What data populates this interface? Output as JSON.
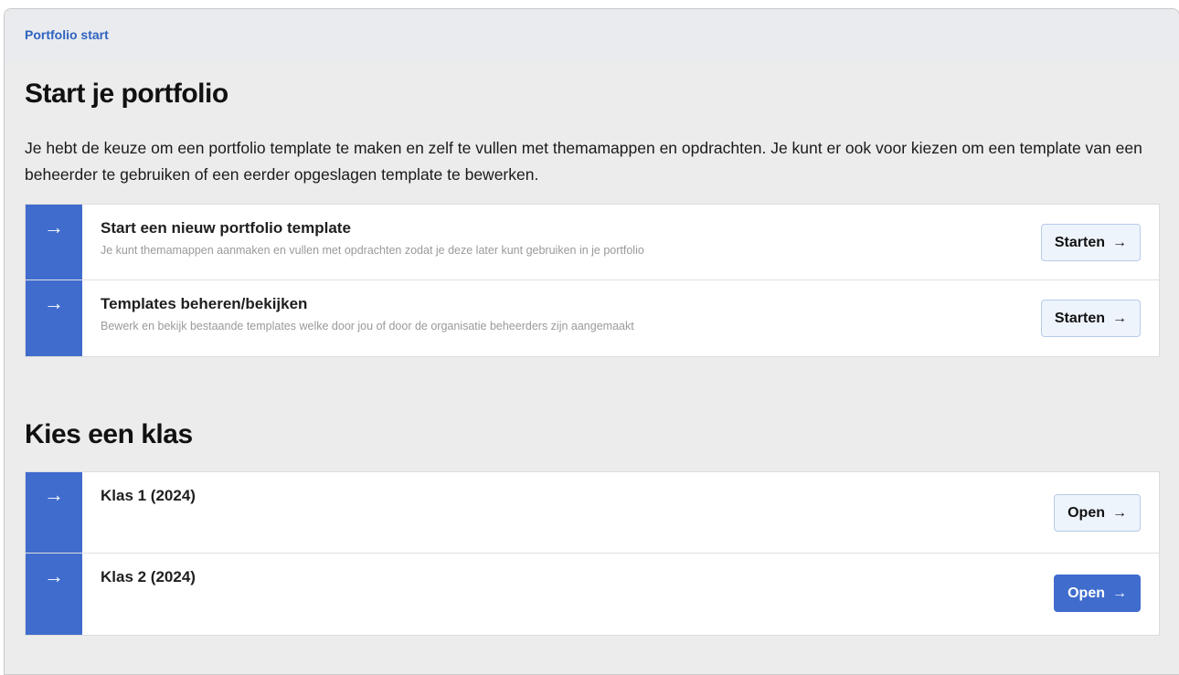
{
  "breadcrumb": "Portfolio start",
  "start_section": {
    "title": "Start je portfolio",
    "intro": "Je hebt de keuze om een portfolio template te maken en zelf te vullen met themamappen en opdrachten. Je kunt er ook voor kiezen om een template van een beheerder te gebruiken of een eerder opgeslagen template te bewerken.",
    "items": [
      {
        "title": "Start een nieuw portfolio template",
        "description": "Je kunt themamappen aanmaken en vullen met opdrachten zodat je deze later kunt gebruiken in je portfolio",
        "button": "Starten"
      },
      {
        "title": "Templates beheren/bekijken",
        "description": "Bewerk en bekijk bestaande templates welke door jou of door de organisatie beheerders zijn aangemaakt",
        "button": "Starten"
      }
    ]
  },
  "class_section": {
    "title": "Kies een klas",
    "items": [
      {
        "title": "Klas 1 (2024)",
        "button": "Open",
        "state": "default"
      },
      {
        "title": "Klas 2 (2024)",
        "button": "Open",
        "state": "hover"
      }
    ]
  },
  "icons": {
    "row_arrow": "→",
    "button_arrow": "→"
  },
  "colors": {
    "accent": "#3f6ccd",
    "link": "#2f62c0",
    "button_bg": "#eef4fc"
  }
}
